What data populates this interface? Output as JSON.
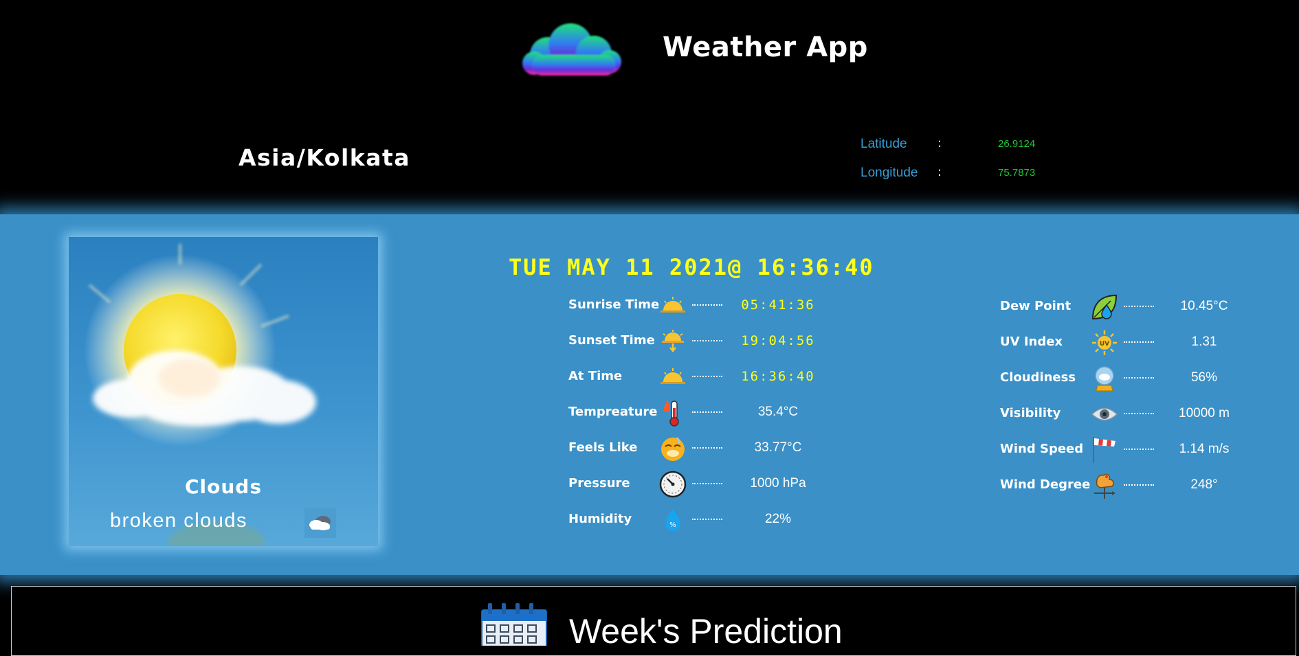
{
  "header": {
    "app_title": "Weather App",
    "logo_icon": "cloud-logo-icon"
  },
  "location": {
    "timezone": "Asia/Kolkata",
    "latitude_label": "Latitude",
    "latitude_value": "26.9124",
    "longitude_label": "Longitude",
    "longitude_value": "75.7873",
    "separator": ":"
  },
  "current": {
    "condition": "Clouds",
    "description": "broken clouds",
    "condition_icon": "broken-clouds-icon",
    "datetime": "TUE MAY 11 2021@ 16:36:40"
  },
  "left_details": [
    {
      "label": "Sunrise Time",
      "value": "05:41:36",
      "icon": "sunrise-icon",
      "is_time": true
    },
    {
      "label": "Sunset Time",
      "value": "19:04:56",
      "icon": "sunset-icon",
      "is_time": true
    },
    {
      "label": "At Time",
      "value": "16:36:40",
      "icon": "sun-horizon-icon",
      "is_time": true
    },
    {
      "label": "Tempreature",
      "value": "35.4°C",
      "icon": "thermometer-fire-icon",
      "is_time": false
    },
    {
      "label": "Feels Like",
      "value": "33.77°C",
      "icon": "hot-face-icon",
      "is_time": false
    },
    {
      "label": "Pressure",
      "value": "1000 hPa",
      "icon": "pressure-gauge-icon",
      "is_time": false
    },
    {
      "label": "Humidity",
      "value": "22%",
      "icon": "humidity-drop-icon",
      "is_time": false
    }
  ],
  "right_details": [
    {
      "label": "Dew Point",
      "value": "10.45°C",
      "icon": "dew-leaf-icon"
    },
    {
      "label": "UV Index",
      "value": "1.31",
      "icon": "uv-sun-icon"
    },
    {
      "label": "Cloudiness",
      "value": "56%",
      "icon": "cloudiness-orb-icon"
    },
    {
      "label": "Visibility",
      "value": "10000 m",
      "icon": "eye-visibility-icon"
    },
    {
      "label": "Wind Speed",
      "value": "1.14 m/s",
      "icon": "windsock-icon"
    },
    {
      "label": "Wind Degree",
      "value": "248°",
      "icon": "weathervane-rooster-icon"
    }
  ],
  "forecast": {
    "title": "Week's Prediction",
    "icon": "calendar-icon"
  },
  "colors": {
    "panel_blue": "#3a90c7",
    "accent_yellow": "#ffff1a",
    "coord_label_blue": "#3a9ed4",
    "coord_value_green": "#22c43a"
  }
}
